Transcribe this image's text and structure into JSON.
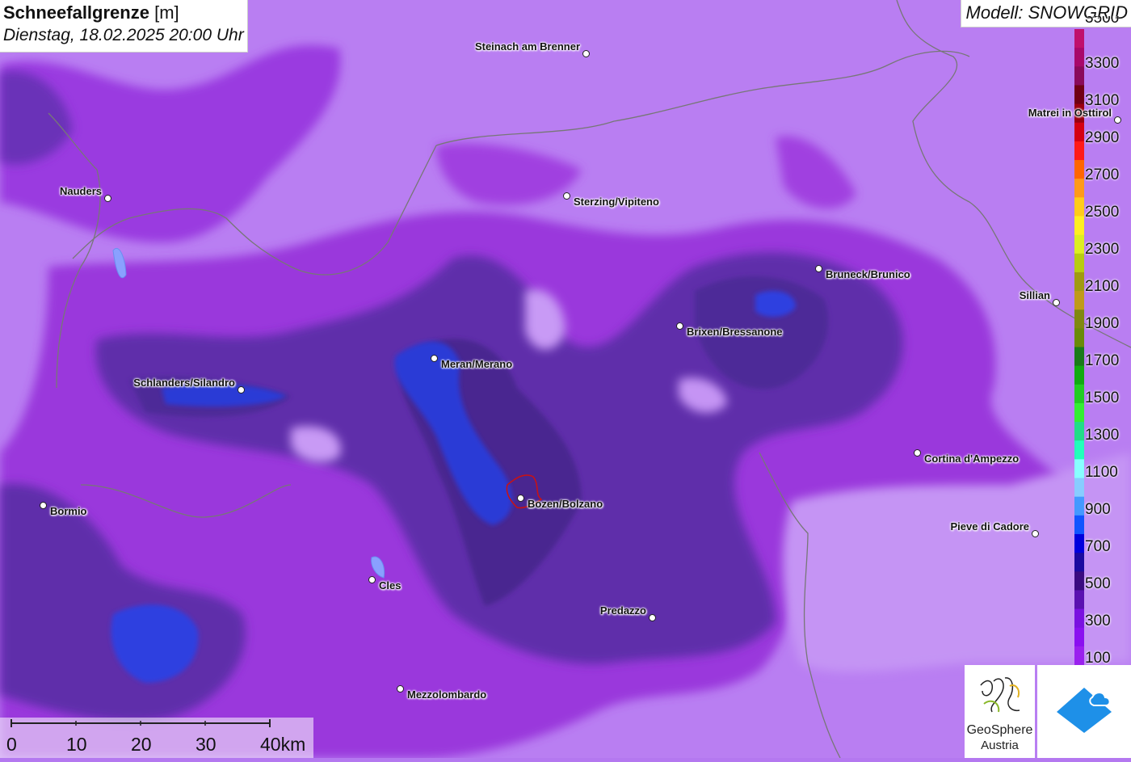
{
  "title": {
    "main": "Schneefallgrenze",
    "unit": "[m]",
    "datetime": "Dienstag, 18.02.2025 20:00 Uhr"
  },
  "model_label": "Modell: SNOWGRID",
  "cities": [
    {
      "name": "Steinach am Brenner",
      "label_side": "left"
    },
    {
      "name": "Matrei in Osttirol",
      "label_side": "left"
    },
    {
      "name": "Nauders",
      "label_side": "left"
    },
    {
      "name": "Sterzing/Vipiteno",
      "label_side": "right"
    },
    {
      "name": "Bruneck/Brunico",
      "label_side": "right"
    },
    {
      "name": "Sillian",
      "label_side": "left"
    },
    {
      "name": "Brixen/Bressanone",
      "label_side": "right"
    },
    {
      "name": "Meran/Merano",
      "label_side": "right"
    },
    {
      "name": "Schlanders/Silandro",
      "label_side": "left"
    },
    {
      "name": "Cortina d'Ampezzo",
      "label_side": "right"
    },
    {
      "name": "Bozen/Bolzano",
      "label_side": "right"
    },
    {
      "name": "Bormio",
      "label_side": "right"
    },
    {
      "name": "Pieve di Cadore",
      "label_side": "left"
    },
    {
      "name": "Cles",
      "label_side": "right"
    },
    {
      "name": "Predazzo",
      "label_side": "left"
    },
    {
      "name": "Mezzolombardo",
      "label_side": "right"
    }
  ],
  "legend": {
    "labels": [
      "3500",
      "3300",
      "3100",
      "2900",
      "2700",
      "2500",
      "2300",
      "2100",
      "1900",
      "1700",
      "1500",
      "1300",
      "1100",
      "900",
      "700",
      "500",
      "300",
      "100"
    ],
    "colors": [
      "#c0106c",
      "#a8086a",
      "#8a0a5a",
      "#700014",
      "#9a0010",
      "#d40012",
      "#ff1a1a",
      "#ff6600",
      "#ff9a1a",
      "#ffcc1a",
      "#ffee22",
      "#ddee22",
      "#b8cc11",
      "#a09a11",
      "#c09a1a",
      "#808811",
      "#6a8a08",
      "#1a7a1a",
      "#11aa11",
      "#22cc22",
      "#33ee33",
      "#22dd88",
      "#22ffbb",
      "#88ffff",
      "#88ccff",
      "#4499ff",
      "#1155ff",
      "#0000dd",
      "#1a0aa0",
      "#3a0a80",
      "#5a10b0",
      "#7a10e0",
      "#8a10f0",
      "#9a20ee"
    ]
  },
  "scale": {
    "ticks": [
      "0",
      "10",
      "20",
      "30",
      "40km"
    ]
  },
  "logos": {
    "geosphere_line1": "GeoSphere",
    "geosphere_line2": "Austria"
  },
  "colors": {
    "snowline_low": "#2a3ad8",
    "snowline_mid": "#5a2ea8",
    "snowline_high": "#b478f0",
    "border": "#777777",
    "bolzano_outline": "#cc1111"
  }
}
